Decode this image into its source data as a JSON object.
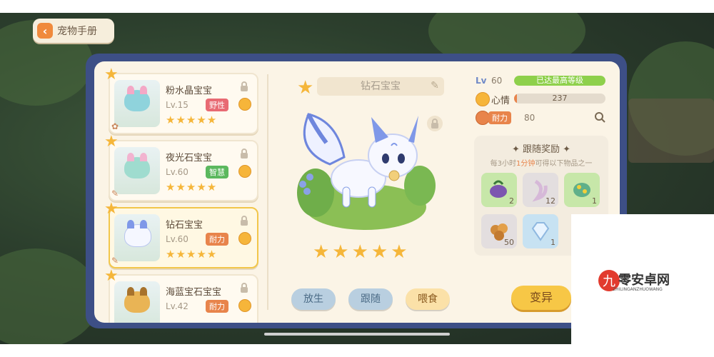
{
  "header": {
    "back_label": "宠物手册"
  },
  "pets": [
    {
      "name": "粉水晶宝宝",
      "level": "Lv.15",
      "trait": "野性",
      "trait_color": "#e86a73",
      "stars": "★★★★★",
      "colors": [
        "#8fd3dc",
        "#f4a8c6"
      ]
    },
    {
      "name": "夜光石宝宝",
      "level": "Lv.60",
      "trait": "智慧",
      "trait_color": "#5bb85e",
      "stars": "★★★★★",
      "colors": [
        "#9fdccf",
        "#f2b4d0"
      ]
    },
    {
      "name": "钻石宝宝",
      "level": "Lv.60",
      "trait": "耐力",
      "trait_color": "#e8844b",
      "stars": "★★★★★",
      "colors": [
        "#f5f7ff",
        "#7f98e8"
      ]
    },
    {
      "name": "海蓝宝石宝宝",
      "level": "Lv.42",
      "trait": "耐力",
      "trait_color": "#e8844b",
      "stars": "",
      "colors": [
        "#e9b455",
        "#a7722c"
      ]
    }
  ],
  "detail": {
    "name": "钻石宝宝",
    "stars": "★★★★★",
    "buttons": {
      "release": "放生",
      "follow": "跟随",
      "feed": "喂食"
    },
    "colors": {
      "release": "#b9cfe0",
      "follow": "#b9cfe0",
      "feed": "#fbe1a8"
    }
  },
  "stats": {
    "lv_tag": "Lv",
    "lv_value": "60",
    "lv_status": "已达最高等级",
    "mood_label": "心情",
    "mood_value": "237",
    "mood_fraction": 0.03,
    "endure_tag": "耐力",
    "endure_value": "80"
  },
  "reward": {
    "title": "跟随奖励",
    "desc_pre": "每3小时",
    "desc_hl": "1分钟",
    "desc_post": "可得以下物品之一",
    "items": [
      {
        "icon": "purple-fruit-icon",
        "count": "2",
        "color": "#c7e7a9"
      },
      {
        "icon": "ribbon-icon",
        "count": "12",
        "color": "#e3dedf"
      },
      {
        "icon": "green-beetle-icon",
        "count": "1",
        "color": "#c7e7a9"
      },
      {
        "icon": "nut-cluster-icon",
        "count": "50",
        "color": "#e3dedf"
      },
      {
        "icon": "diamond-icon",
        "count": "1",
        "color": "#c7e2f2"
      }
    ]
  },
  "mutate_label": "变异",
  "watermark": {
    "text": "零安卓网",
    "sub": "ZHILINGANZHUOWANG"
  }
}
